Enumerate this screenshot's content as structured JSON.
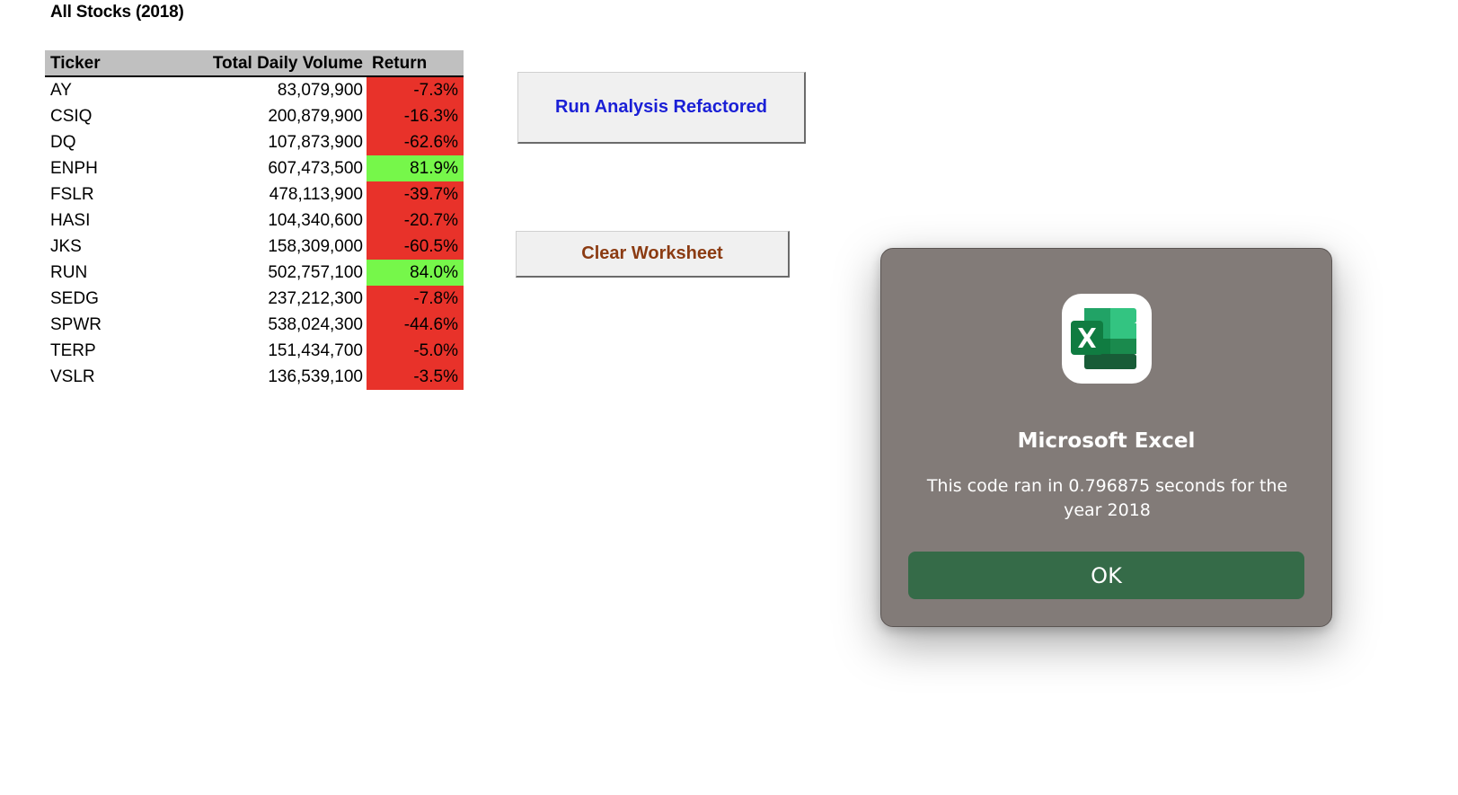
{
  "sheet": {
    "title": "All Stocks (2018)",
    "columns": {
      "ticker": "Ticker",
      "volume": "Total Daily Volume",
      "return": "Return"
    },
    "rows": [
      {
        "ticker": "AY",
        "volume": "83,079,900",
        "return": "-7.3%",
        "status": "neg"
      },
      {
        "ticker": "CSIQ",
        "volume": "200,879,900",
        "return": "-16.3%",
        "status": "neg"
      },
      {
        "ticker": "DQ",
        "volume": "107,873,900",
        "return": "-62.6%",
        "status": "neg"
      },
      {
        "ticker": "ENPH",
        "volume": "607,473,500",
        "return": "81.9%",
        "status": "pos"
      },
      {
        "ticker": "FSLR",
        "volume": "478,113,900",
        "return": "-39.7%",
        "status": "neg"
      },
      {
        "ticker": "HASI",
        "volume": "104,340,600",
        "return": "-20.7%",
        "status": "neg"
      },
      {
        "ticker": "JKS",
        "volume": "158,309,000",
        "return": "-60.5%",
        "status": "neg"
      },
      {
        "ticker": "RUN",
        "volume": "502,757,100",
        "return": "84.0%",
        "status": "pos"
      },
      {
        "ticker": "SEDG",
        "volume": "237,212,300",
        "return": "-7.8%",
        "status": "neg"
      },
      {
        "ticker": "SPWR",
        "volume": "538,024,300",
        "return": "-44.6%",
        "status": "neg"
      },
      {
        "ticker": "TERP",
        "volume": "151,434,700",
        "return": "-5.0%",
        "status": "neg"
      },
      {
        "ticker": "VSLR",
        "volume": "136,539,100",
        "return": "-3.5%",
        "status": "neg"
      }
    ]
  },
  "buttons": {
    "run_analysis": "Run Analysis Refactored",
    "clear_worksheet": "Clear Worksheet"
  },
  "dialog": {
    "icon": "excel-app-icon",
    "title": "Microsoft Excel",
    "message": "This code ran in 0.796875 seconds for the year 2018",
    "ok_label": "OK"
  },
  "colors": {
    "negative_fill": "#e8322a",
    "positive_fill": "#76f74a",
    "run_button_text": "#1a1fd6",
    "clear_button_text": "#8b3b12",
    "dialog_bg": "#827b78",
    "ok_button_bg": "#356b48"
  }
}
